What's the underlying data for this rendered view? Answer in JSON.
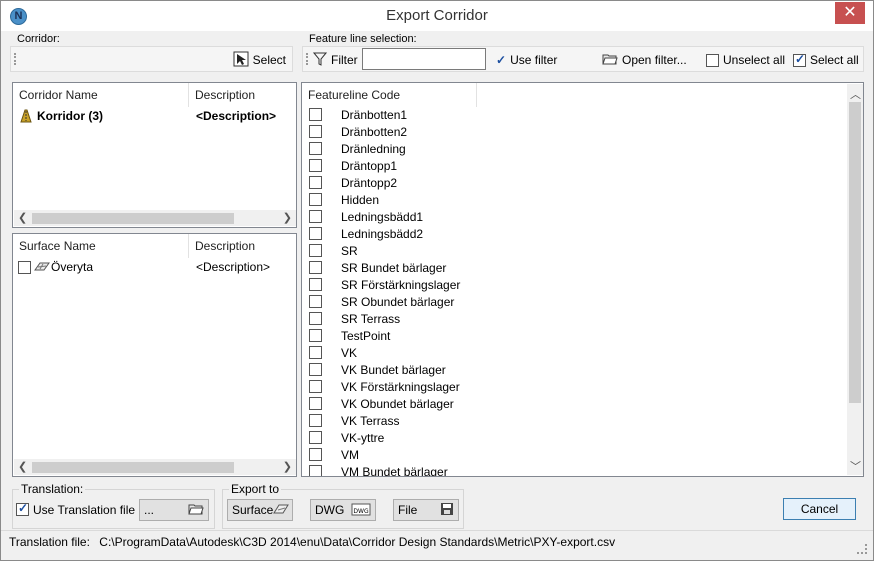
{
  "window": {
    "title": "Export Corridor",
    "close_label": "✕",
    "app_icon_label": "N"
  },
  "corridor_group": {
    "label": "Corridor:",
    "select_label": "Select"
  },
  "feature_group": {
    "label": "Feature line selection:",
    "filter_label": "Filter",
    "filter_value": "",
    "use_filter_label": "Use filter",
    "open_filter_label": "Open filter...",
    "unselect_all_label": "Unselect all",
    "select_all_label": "Select all"
  },
  "corridor_table": {
    "headers": [
      "Corridor Name",
      "Description"
    ],
    "rows": [
      {
        "name": "Korridor (3)",
        "description": "<Description>"
      }
    ]
  },
  "surface_table": {
    "headers": [
      "Surface Name",
      "Description"
    ],
    "rows": [
      {
        "name": "Överyta",
        "description": "<Description>"
      }
    ]
  },
  "featureline_table": {
    "header": "Featureline Code",
    "rows": [
      "Dränbotten1",
      "Dränbotten2",
      "Dränledning",
      "Dräntopp1",
      "Dräntopp2",
      "Hidden",
      "Ledningsbädd1",
      "Ledningsbädd2",
      "SR",
      "SR Bundet bärlager",
      "SR Förstärkningslager",
      "SR Obundet bärlager",
      "SR Terrass",
      "TestPoint",
      "VK",
      "VK Bundet bärlager",
      "VK Förstärkningslager",
      "VK Obundet bärlager",
      "VK Terrass",
      "VK-yttre",
      "VM",
      "VM Bundet bärlager"
    ]
  },
  "translation": {
    "label": "Translation:",
    "use_file_label": "Use Translation file",
    "file_value": "..."
  },
  "export_to": {
    "label": "Export to",
    "surface_label": "Surface",
    "dwg_label": "DWG",
    "file_label": "File"
  },
  "cancel_label": "Cancel",
  "status": {
    "label": "Translation file:",
    "path": "C:\\ProgramData\\Autodesk\\C3D 2014\\enu\\Data\\Corridor Design Standards\\Metric\\PXY-export.csv"
  }
}
